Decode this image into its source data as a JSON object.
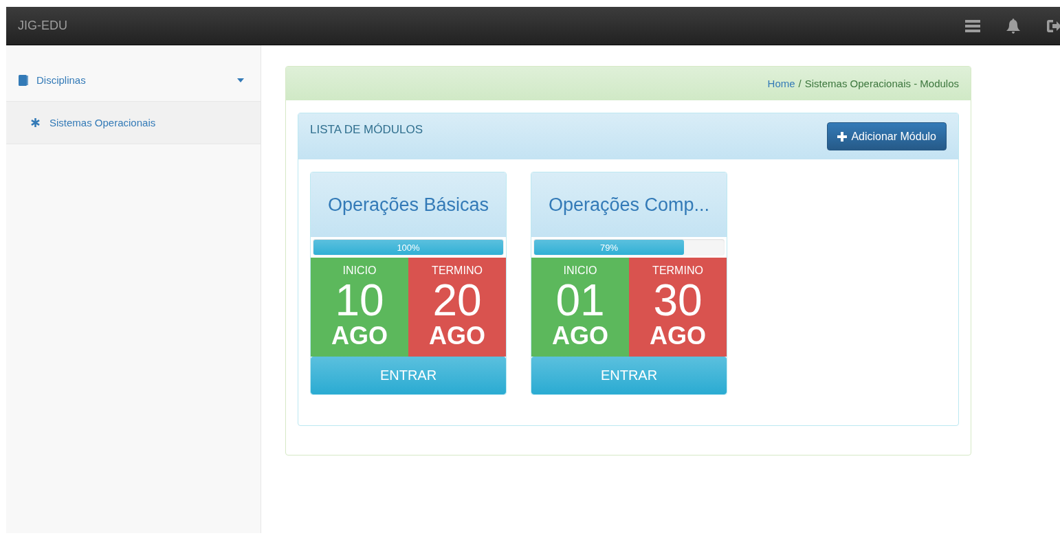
{
  "navbar": {
    "brand": "JIG-EDU"
  },
  "sidebar": {
    "items": [
      {
        "label": "Disciplinas",
        "expanded": true,
        "children": [
          {
            "label": "Sistemas Operacionais"
          }
        ]
      }
    ]
  },
  "breadcrumb": {
    "link": "Home",
    "separator": "/",
    "current": "Sistemas Operacionais - Modulos"
  },
  "modules_panel": {
    "title": "LISTA DE MÓDULOS",
    "add_button": "Adicionar Módulo",
    "modules": [
      {
        "title": "Operações Básicas",
        "level": 1,
        "progress_label": "100%",
        "start": {
          "label": "INICIO",
          "day": "10",
          "month": "AGO"
        },
        "end": {
          "label": "TERMINO",
          "day": "20",
          "month": "AGO"
        },
        "button": "ENTRAR"
      },
      {
        "title": "Operações Comp...",
        "level": 0.79,
        "progress_label": "79%",
        "start": {
          "label": "INICIO",
          "day": "01",
          "month": "AGO"
        },
        "end": {
          "label": "TERMINO",
          "day": "30",
          "month": "AGO"
        },
        "button": "ENTRAR"
      }
    ]
  }
}
